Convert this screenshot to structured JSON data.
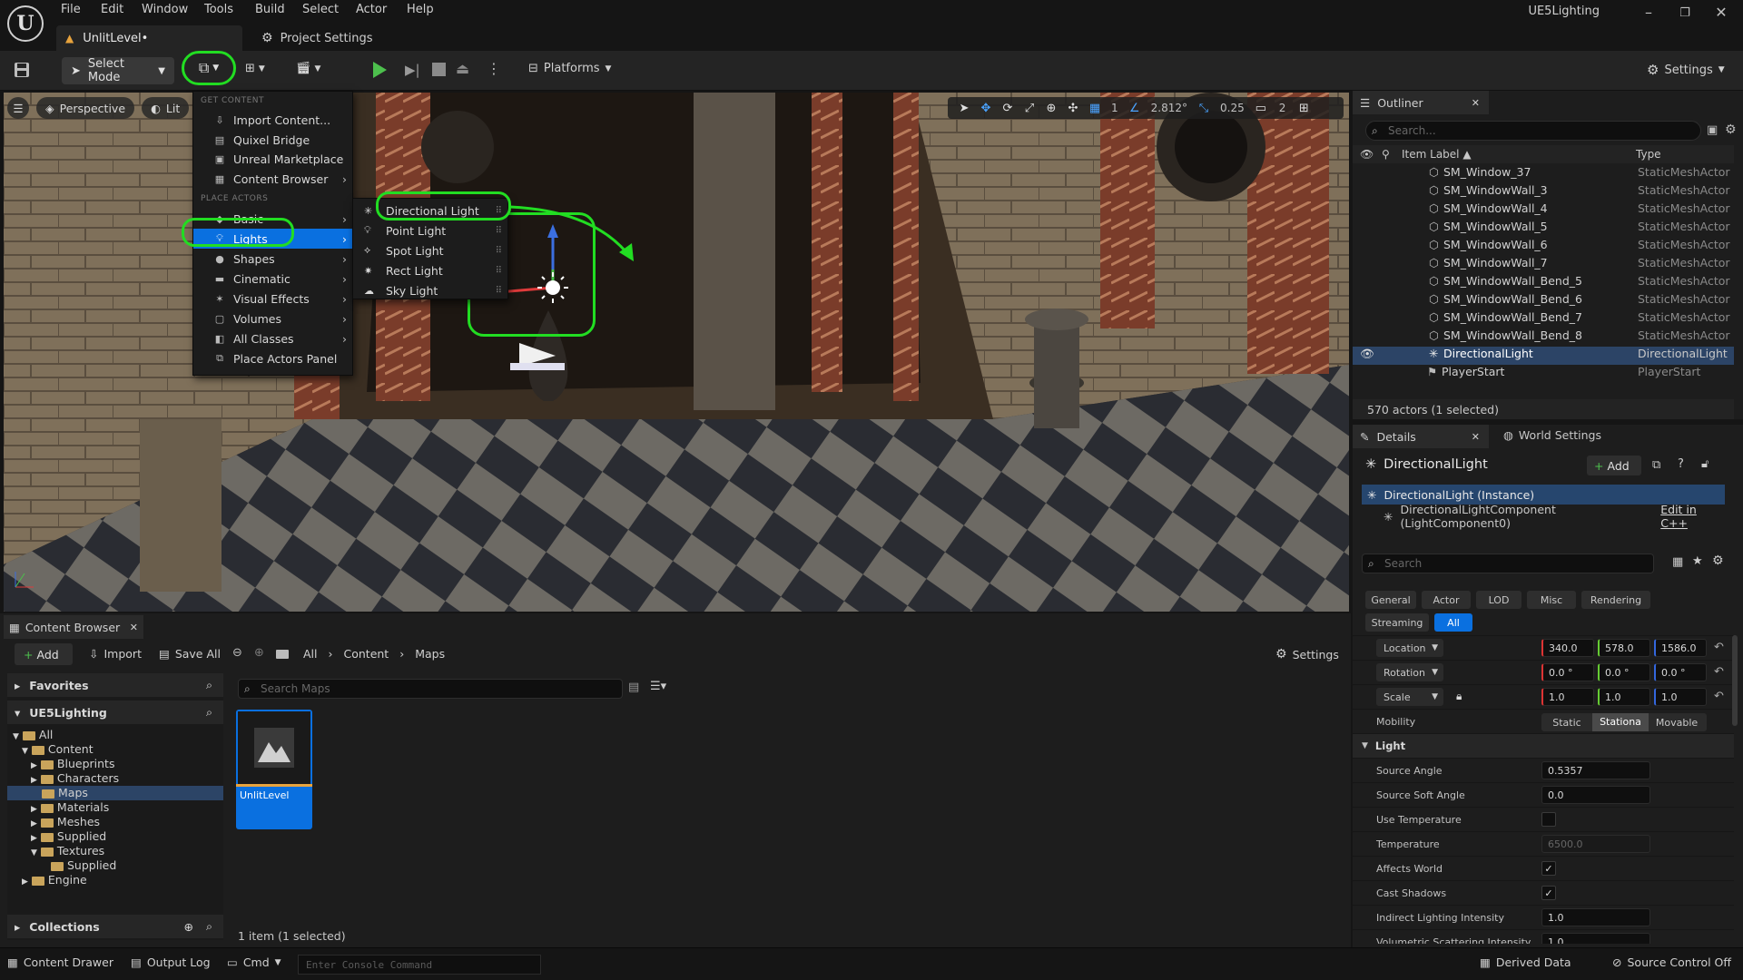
{
  "app": {
    "menu": [
      "File",
      "Edit",
      "Window",
      "Tools",
      "Build",
      "Select",
      "Actor",
      "Help"
    ],
    "project_name": "UE5Lighting",
    "level_tab": "UnlitLevel•",
    "project_settings_tab": "Project Settings"
  },
  "toolbar": {
    "select_mode": "Select Mode",
    "platforms": "Platforms",
    "settings": "Settings"
  },
  "viewport": {
    "perspective": "Perspective",
    "lit": "Lit",
    "grid_value": "1",
    "angle_value": "2.812°",
    "scale_value": "0.25",
    "camera_speed": "2"
  },
  "place_menu": {
    "get_content_header": "GET CONTENT",
    "get_content": [
      "Import Content...",
      "Quixel Bridge",
      "Unreal Marketplace",
      "Content Browser"
    ],
    "place_actors_header": "PLACE ACTORS",
    "place_actors": [
      "Basic",
      "Lights",
      "Shapes",
      "Cinematic",
      "Visual Effects",
      "Volumes",
      "All Classes",
      "Place Actors Panel"
    ],
    "lights_submenu": [
      "Directional Light",
      "Point Light",
      "Spot Light",
      "Rect Light",
      "Sky Light"
    ]
  },
  "outliner": {
    "title": "Outliner",
    "search_placeholder": "Search...",
    "col_label": "Item Label ▲",
    "col_type": "Type",
    "rows": [
      {
        "label": "SM_Window_37",
        "type": "StaticMeshActor"
      },
      {
        "label": "SM_WindowWall_3",
        "type": "StaticMeshActor"
      },
      {
        "label": "SM_WindowWall_4",
        "type": "StaticMeshActor"
      },
      {
        "label": "SM_WindowWall_5",
        "type": "StaticMeshActor"
      },
      {
        "label": "SM_WindowWall_6",
        "type": "StaticMeshActor"
      },
      {
        "label": "SM_WindowWall_7",
        "type": "StaticMeshActor"
      },
      {
        "label": "SM_WindowWall_Bend_5",
        "type": "StaticMeshActor"
      },
      {
        "label": "SM_WindowWall_Bend_6",
        "type": "StaticMeshActor"
      },
      {
        "label": "SM_WindowWall_Bend_7",
        "type": "StaticMeshActor"
      },
      {
        "label": "SM_WindowWall_Bend_8",
        "type": "StaticMeshActor"
      },
      {
        "label": "DirectionalLight",
        "type": "DirectionalLight"
      },
      {
        "label": "PlayerStart",
        "type": "PlayerStart"
      }
    ],
    "actor_count": "570 actors (1 selected)"
  },
  "details": {
    "tab_details": "Details",
    "tab_world_settings": "World Settings",
    "actor_name": "DirectionalLight",
    "add_button": "Add",
    "instance": "DirectionalLight (Instance)",
    "component": "DirectionalLightComponent (LightComponent0)",
    "edit_in_cpp": "Edit in C++",
    "search_placeholder": "Search",
    "filters": [
      "General",
      "Actor",
      "LOD",
      "Misc",
      "Rendering",
      "Streaming",
      "All"
    ],
    "location_label": "Location",
    "location": [
      "340.0",
      "578.0",
      "1586.0"
    ],
    "rotation_label": "Rotation",
    "rotation": [
      "0.0 °",
      "0.0 °",
      "0.0 °"
    ],
    "scale_label": "Scale",
    "scale": [
      "1.0",
      "1.0",
      "1.0"
    ],
    "mobility_label": "Mobility",
    "mobility_options": [
      "Static",
      "Stationa",
      "Movable"
    ],
    "light_section": "Light",
    "source_angle_label": "Source Angle",
    "source_angle": "0.5357",
    "source_soft_angle_label": "Source Soft Angle",
    "source_soft_angle": "0.0",
    "use_temperature_label": "Use Temperature",
    "temperature_label": "Temperature",
    "temperature": "6500.0",
    "affects_world_label": "Affects World",
    "cast_shadows_label": "Cast Shadows",
    "indirect_label": "Indirect Lighting Intensity",
    "indirect": "1.0",
    "volumetric_label": "Volumetric Scattering Intensity",
    "volumetric": "1.0"
  },
  "content_browser": {
    "title": "Content Browser",
    "add": "Add",
    "import": "Import",
    "save_all": "Save All",
    "breadcrumb": [
      "All",
      "Content",
      "Maps"
    ],
    "settings": "Settings",
    "favorites": "Favorites",
    "project": "UE5Lighting",
    "tree": [
      "All",
      "Content",
      "Blueprints",
      "Characters",
      "Maps",
      "Materials",
      "Meshes",
      "Supplied",
      "Textures",
      "Supplied",
      "Engine"
    ],
    "collections": "Collections",
    "search_placeholder": "Search Maps",
    "asset_name": "UnlitLevel",
    "item_count": "1 item (1 selected)"
  },
  "statusbar": {
    "content_drawer": "Content Drawer",
    "output_log": "Output Log",
    "cmd": "Cmd",
    "console_placeholder": "Enter Console Command",
    "derived_data": "Derived Data",
    "source_control": "Source Control Off"
  }
}
